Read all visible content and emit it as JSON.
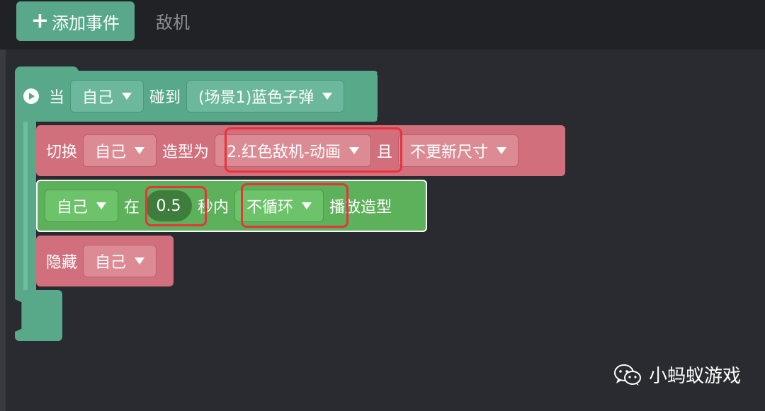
{
  "toolbar": {
    "add_event_label": "添加事件",
    "tab_label": "敌机"
  },
  "hat_block": {
    "when_label": "当",
    "subject": "自己",
    "touch_label": "碰到",
    "target": "(场景1)蓝色子弹"
  },
  "switch_block": {
    "switch_label": "切换",
    "subject": "自己",
    "costume_label": "造型为",
    "costume": "2.红色敌机-动画",
    "and_label": "且",
    "size_option": "不更新尺寸"
  },
  "play_block": {
    "subject": "自己",
    "in_label": "在",
    "seconds": "0.5",
    "seconds_label": "秒内",
    "loop_option": "不循环",
    "play_label": "播放造型"
  },
  "hide_block": {
    "hide_label": "隐藏",
    "subject": "自己"
  },
  "watermark": {
    "text": "小蚂蚁游戏"
  },
  "colors": {
    "event_block": "#58a88a",
    "looks_block": "#d1707c",
    "animation_block": "#5db15b",
    "highlight": "#e8323c",
    "background": "#2a2b30"
  }
}
